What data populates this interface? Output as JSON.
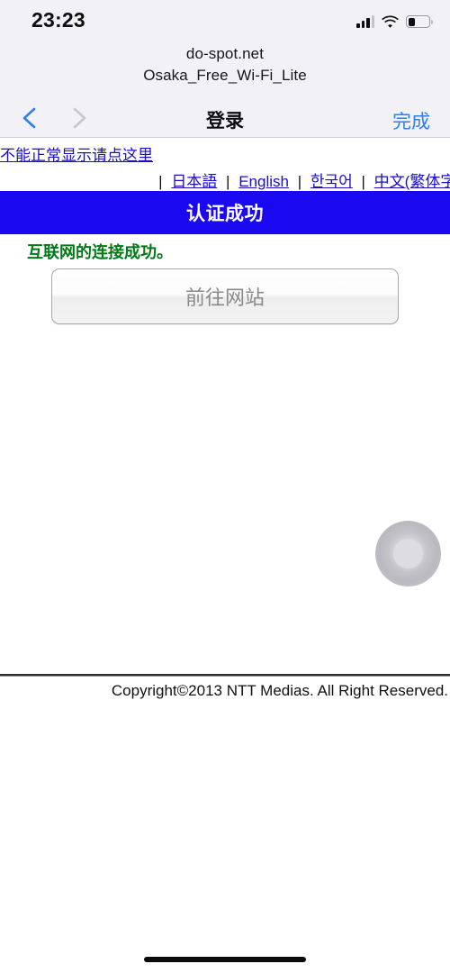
{
  "status_bar": {
    "time": "23:23",
    "signal_icon": "cellular-signal-icon",
    "wifi_icon": "wifi-icon",
    "battery_icon": "battery-low-icon",
    "battery_level_percent": 28
  },
  "sheet_header": {
    "host": "do-spot.net",
    "ssid": "Osaka_Free_Wi-Fi_Lite"
  },
  "navbar": {
    "back_icon": "chevron-left-icon",
    "forward_icon": "chevron-right-icon",
    "title": "登录",
    "done_label": "完成",
    "accent_color": "#2d7ff0",
    "disabled_color": "#c3c3ca"
  },
  "page": {
    "retry_link": "不能正常显示请点这里",
    "language_separator": "|",
    "languages": [
      {
        "label": "日本語"
      },
      {
        "label": "English"
      },
      {
        "label": "한국어"
      },
      {
        "label": "中文(繁体字)"
      }
    ],
    "banner": {
      "text": "认证成功",
      "background_color": "#1a08f0",
      "text_color": "#ffffff"
    },
    "success_message": "互联网的连接成功。",
    "success_message_color": "#007a18",
    "primary_button_label": "前往网站",
    "footer_text": "Copyright©2013 NTT Medias. All Right Reserved."
  },
  "overlay": {
    "assistive_touch_icon": "assistive-touch-icon"
  },
  "home_indicator": {
    "icon": "home-indicator-bar"
  }
}
